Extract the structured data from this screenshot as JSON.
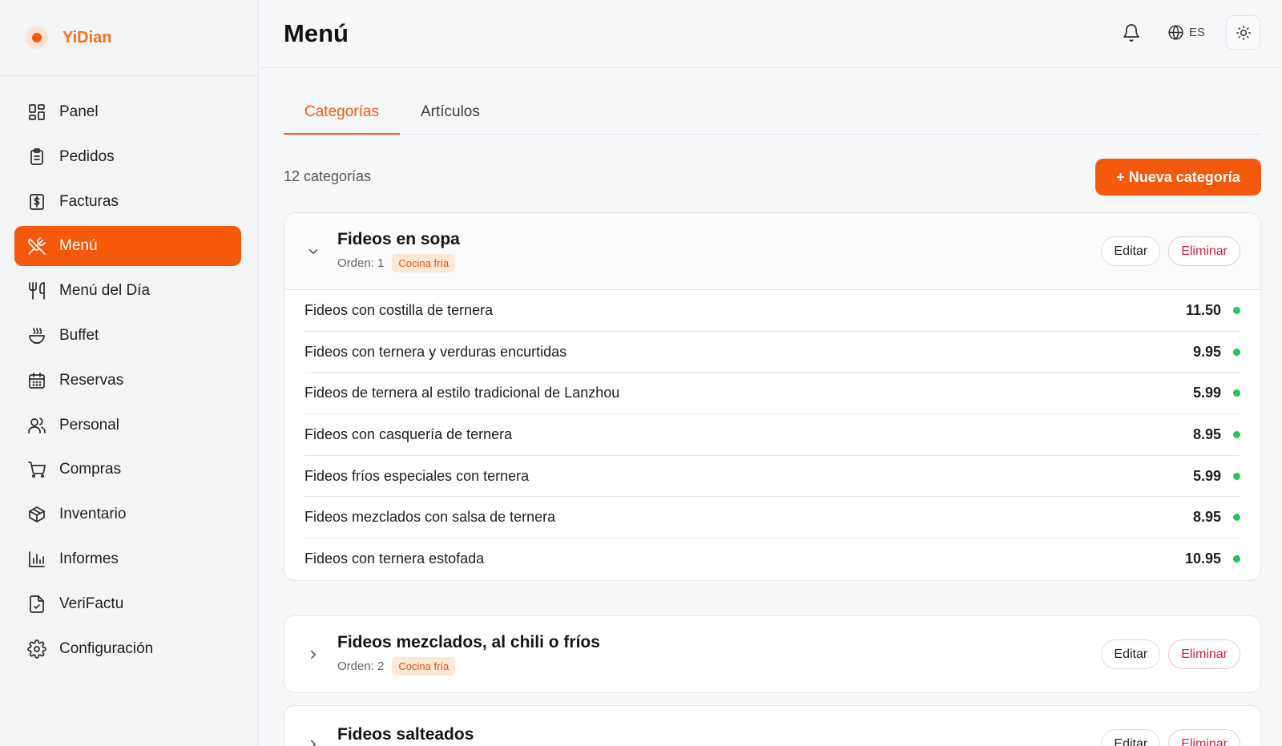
{
  "brand": {
    "name": "YiDian"
  },
  "sidebar": {
    "items": [
      {
        "label": "Panel",
        "icon": "dashboard-icon",
        "active": false
      },
      {
        "label": "Pedidos",
        "icon": "clipboard-icon",
        "active": false
      },
      {
        "label": "Facturas",
        "icon": "invoice-icon",
        "active": false
      },
      {
        "label": "Menú",
        "icon": "utensils-crossed-icon",
        "active": true
      },
      {
        "label": "Menú del Día",
        "icon": "fork-knife-icon",
        "active": false
      },
      {
        "label": "Buffet",
        "icon": "bowl-steam-icon",
        "active": false
      },
      {
        "label": "Reservas",
        "icon": "calendar-icon",
        "active": false
      },
      {
        "label": "Personal",
        "icon": "users-icon",
        "active": false
      },
      {
        "label": "Compras",
        "icon": "cart-icon",
        "active": false
      },
      {
        "label": "Inventario",
        "icon": "package-icon",
        "active": false
      },
      {
        "label": "Informes",
        "icon": "bar-chart-icon",
        "active": false
      },
      {
        "label": "VeriFactu",
        "icon": "file-check-icon",
        "active": false
      },
      {
        "label": "Configuración",
        "icon": "gear-icon",
        "active": false
      }
    ]
  },
  "header": {
    "title": "Menú",
    "language": "ES"
  },
  "tabs": [
    {
      "label": "Categorías",
      "active": true
    },
    {
      "label": "Artículos",
      "active": false
    }
  ],
  "summary": {
    "count": "12 categorías",
    "new_button": "+ Nueva categoría"
  },
  "colors": {
    "accent": "#f5590c",
    "brand_text": "#f5721a",
    "available": "#22c55e",
    "danger": "#d21f3c"
  },
  "categories": [
    {
      "name": "Fideos en sopa",
      "order": "Orden: 1",
      "tag": "Cocina fría",
      "expanded": true,
      "edit_label": "Editar",
      "delete_label": "Eliminar",
      "items": [
        {
          "name": "Fideos con costilla de ternera",
          "price": "11.50"
        },
        {
          "name": "Fideos con ternera y verduras encurtidas",
          "price": "9.95"
        },
        {
          "name": "Fideos de ternera al estilo tradicional de Lanzhou",
          "price": "5.99"
        },
        {
          "name": "Fideos con casquería de ternera",
          "price": "8.95"
        },
        {
          "name": "Fideos fríos especiales con ternera",
          "price": "5.99"
        },
        {
          "name": "Fideos mezclados con salsa de ternera",
          "price": "8.95"
        },
        {
          "name": "Fideos con ternera estofada",
          "price": "10.95"
        }
      ]
    },
    {
      "name": "Fideos mezclados, al chili o fríos",
      "order": "Orden: 2",
      "tag": "Cocina fría",
      "expanded": false,
      "edit_label": "Editar",
      "delete_label": "Eliminar"
    },
    {
      "name": "Fideos salteados",
      "expanded": false,
      "edit_label": "Editar",
      "delete_label": "Eliminar"
    }
  ]
}
